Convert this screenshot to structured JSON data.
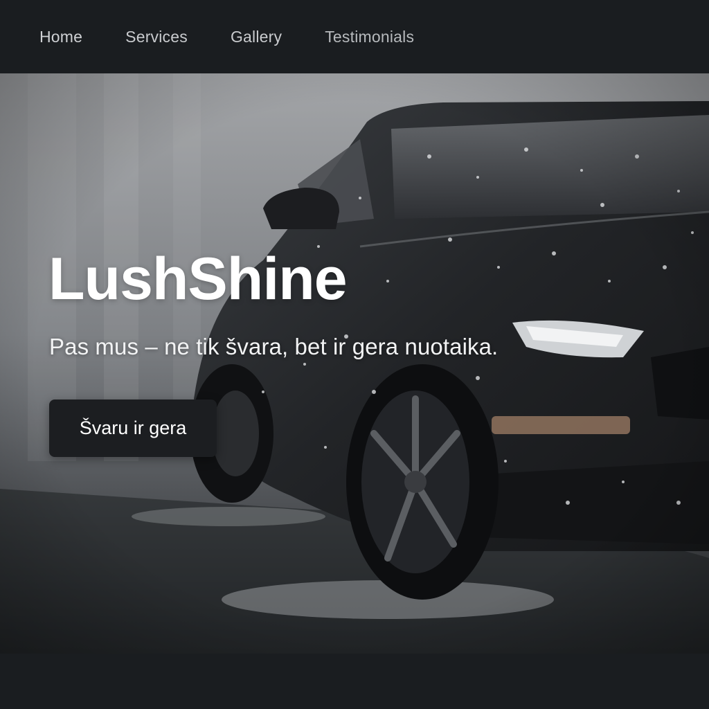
{
  "nav": {
    "items": [
      {
        "label": "Home"
      },
      {
        "label": "Services"
      },
      {
        "label": "Gallery"
      },
      {
        "label": "Testimonials"
      }
    ]
  },
  "hero": {
    "title": "LushShine",
    "tagline": "Pas mus – ne tik švara, bet ir gera nuotaika.",
    "cta_label": "Švaru ir gera",
    "background_image": "black-sports-car-covered-in-foam"
  },
  "colors": {
    "nav_bg": "#1a1d20",
    "button_bg": "#1c1e21",
    "text_light": "#ffffff"
  }
}
